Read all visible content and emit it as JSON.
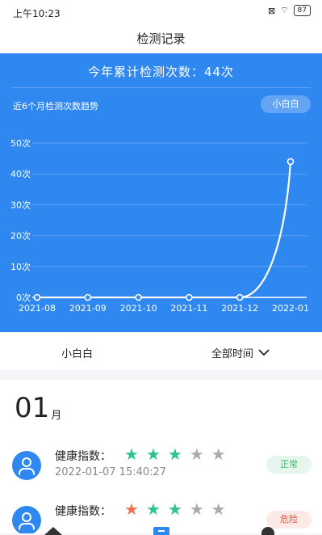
{
  "status": {
    "time": "上午10:23",
    "battery": "87",
    "wifi": "wifi-icon",
    "sim": "sim-off-icon"
  },
  "header": {
    "title": "检测记录"
  },
  "summary": {
    "text": "今年累计检测次数：44次"
  },
  "chart_section": {
    "subtitle": "近6个月检测次数趋势",
    "user_pill": "小白白"
  },
  "chart_data": {
    "type": "line",
    "categories": [
      "2021-08",
      "2021-09",
      "2021-10",
      "2021-11",
      "2021-12",
      "2022-01"
    ],
    "series": [
      {
        "values": [
          0,
          0,
          0,
          0,
          0,
          44
        ]
      }
    ],
    "yticks": [
      "0次",
      "10次",
      "20次",
      "30次",
      "40次",
      "50次"
    ],
    "ylim": [
      0,
      50
    ],
    "colors": {
      "line": "#ffffff",
      "background": "#2f87f0"
    }
  },
  "filter": {
    "user": "小白白",
    "range": "全部时间"
  },
  "month": {
    "number": "01",
    "unit": "月"
  },
  "records": [
    {
      "label": "健康指数：",
      "stars": [
        "green",
        "green",
        "green",
        "gray",
        "gray"
      ],
      "date": "2022-01-07 15:40:27",
      "badge": "正常",
      "badge_color": "#39b86a",
      "badge_bg": "#e6f6ec"
    },
    {
      "label": "健康指数：",
      "stars": [
        "red",
        "green",
        "green",
        "gray",
        "gray"
      ],
      "date": "",
      "badge": "危险",
      "badge_color": "#e8503a",
      "badge_bg": "#fde9e6"
    }
  ],
  "colors": {
    "green": "#2bc48a",
    "gray": "#aaaaaa",
    "red": "#f07050",
    "accent": "#2f87f0"
  }
}
